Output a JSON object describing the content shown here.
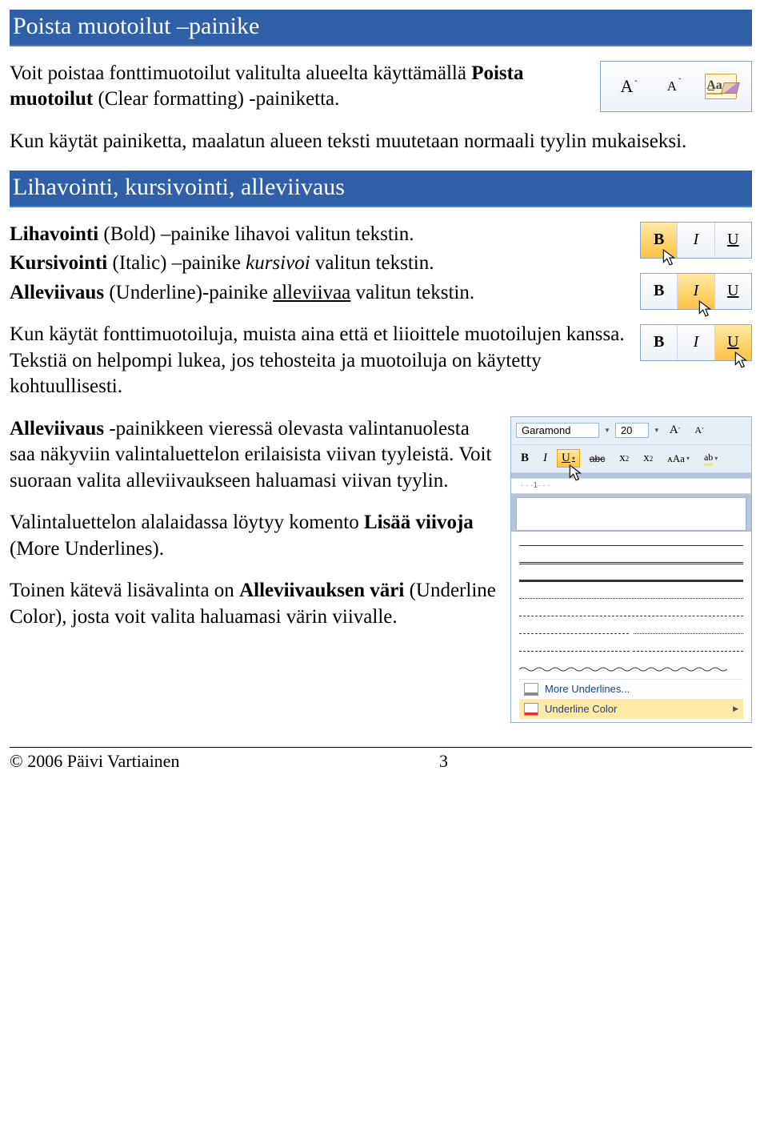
{
  "headings": {
    "h1": "Poista muotoilut –painike",
    "h2": "Lihavointi, kursivointi, alleviivaus"
  },
  "section1": {
    "p1a": "Voit poistaa fonttimuotoilut valitulta alueelta käyttämällä ",
    "p1b": "Poista muotoilut",
    "p1c": " (Clear formatting) -painiketta.",
    "p2": "Kun käytät painiketta, maalatun alueen teksti muutetaan normaali tyylin mukaiseksi."
  },
  "section2": {
    "l1a": "Lihavointi",
    "l1b": " (Bold) –painike lihavoi valitun tekstin.",
    "l2a": "Kursivointi",
    "l2b": " (Italic) –painike ",
    "l2c": "kursivoi",
    "l2d": " valitun tekstin.",
    "l3a": "Alleviivaus",
    "l3b": " (Underline)-painike ",
    "l3c": "alleviivaa",
    "l3d": " valitun tekstin.",
    "p4": "Kun käytät fonttimuotoiluja, muista aina että et liioittele muotoilujen kanssa. Tekstiä on helpompi lukea, jos tehosteita ja muotoiluja on käytetty kohtuullisesti.",
    "p5a": "Alleviivaus",
    "p5b": " -painikkeen vieressä olevasta valintanuolesta saa näkyviin valintaluettelon erilaisista viivan tyyleistä. Voit suoraan valita alleviivaukseen haluamasi viivan tyylin.",
    "p6a": "Valintaluettelon alalaidassa löytyy komento ",
    "p6b": "Lisää viivoja",
    "p6c": " (More Underlines).",
    "p7a": "Toinen kätevä lisävalinta on ",
    "p7b": "Alleviivauksen väri",
    "p7c": " (Underline Color), josta voit valita haluamasi värin viivalle."
  },
  "ribbon_labels": {
    "B": "B",
    "I": "I",
    "U": "U",
    "A": "A"
  },
  "panel": {
    "font_name": "Garamond",
    "font_size": "20",
    "abc": "abc",
    "x": "x",
    "Aa": "ᴀAa",
    "more_underlines": "More Underlines...",
    "underline_color": "Underline Color",
    "ruler_mark": "1"
  },
  "footer": {
    "copyright": "© 2006 Päivi Vartiainen",
    "page": "3"
  }
}
